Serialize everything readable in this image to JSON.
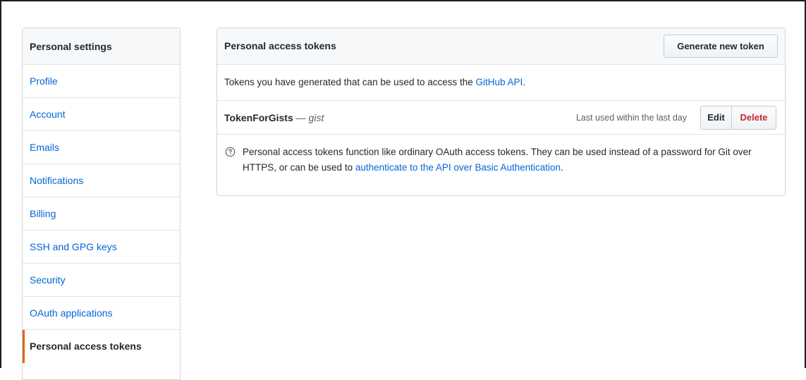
{
  "sidebar": {
    "header": "Personal settings",
    "items": [
      {
        "label": "Profile",
        "selected": false
      },
      {
        "label": "Account",
        "selected": false
      },
      {
        "label": "Emails",
        "selected": false
      },
      {
        "label": "Notifications",
        "selected": false
      },
      {
        "label": "Billing",
        "selected": false
      },
      {
        "label": "SSH and GPG keys",
        "selected": false
      },
      {
        "label": "Security",
        "selected": false
      },
      {
        "label": "OAuth applications",
        "selected": false
      },
      {
        "label": "Personal access tokens",
        "selected": true
      }
    ]
  },
  "panel": {
    "title": "Personal access tokens",
    "generate_button": "Generate new token",
    "intro_text": "Tokens you have generated that can be used to access the ",
    "intro_link": "GitHub API",
    "intro_suffix": ".",
    "token": {
      "name": "TokenForGists",
      "separator": " — ",
      "scope": "gist",
      "last_used": "Last used within the last day",
      "edit_label": "Edit",
      "delete_label": "Delete"
    },
    "note": {
      "icon": "question-circle-icon",
      "text": "Personal access tokens function like ordinary OAuth access tokens. They can be used instead of a password for Git over HTTPS, or can be used to ",
      "link": "authenticate to the API over Basic Authentication",
      "suffix": "."
    }
  },
  "colors": {
    "link": "#0366d6",
    "selected_accent": "#e36209",
    "delete": "#cb2431",
    "header_bg": "#f6f8fa"
  }
}
